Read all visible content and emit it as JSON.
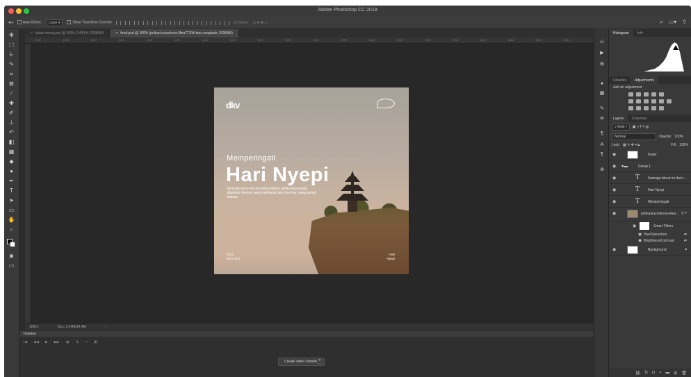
{
  "app": {
    "title": "Adobe Photoshop CC 2018"
  },
  "options_bar": {
    "auto_select_label": "Auto-Select:",
    "auto_select_value": "Layer",
    "transform_label": "Show Transform Controls",
    "mode_3d": "3D Mode:"
  },
  "tabs": [
    {
      "label": "lukas-mieraj.psd @ 100% (1443 H, RGB/8#)",
      "active": false
    },
    {
      "label": "feed.psd @ 100% (polina-kuzovkova-Mea7TXW-tsoc-unsplash, RGB/8#)",
      "active": true
    }
  ],
  "ruler_ticks": [
    "1000",
    "1050",
    "1100",
    "1150",
    "1200",
    "1250",
    "1300",
    "1350",
    "1400",
    "1450",
    "1500",
    "1550",
    "1600",
    "1650",
    "1700",
    "1750",
    "1800",
    "1850",
    "1900",
    "1950"
  ],
  "document": {
    "logo_left": "dkv",
    "pre_title": "Memperingati",
    "title": "Hari Nyepi",
    "body": "Semoga tahun ini dan tahun-tahun berikutnya selalu diberikan berkah yang melimpah dan hari-hari yang penuh makna.",
    "footer_left_line1": "2022",
    "footer_left_line2": "DKV UPJ",
    "footer_right_line1": "Hari",
    "footer_right_line2": "Nyepi"
  },
  "status": {
    "zoom": "100%",
    "doc": "Doc: 3.24M/34.4M"
  },
  "timeline": {
    "title": "Timeline",
    "create_button": "Create Video Timeline"
  },
  "panels": {
    "top_tabs": [
      "Histogram",
      "Info"
    ],
    "mid_tabs": [
      "Libraries",
      "Adjustments"
    ],
    "adjustments_label": "Add an adjustment",
    "layer_tabs": [
      "Layers",
      "Channels"
    ],
    "kind": "Kind",
    "blend_mode": "Normal",
    "opacity_label": "Opacity:",
    "opacity_value": "100%",
    "lock_label": "Lock:",
    "fill_label": "Fill:",
    "fill_value": "100%",
    "layers": [
      {
        "name": "footer",
        "type": "thumb"
      },
      {
        "name": "Group 1",
        "type": "group"
      },
      {
        "name": "Semoga tahun ini dan t...",
        "type": "text"
      },
      {
        "name": "Hari Nyepi",
        "type": "text"
      },
      {
        "name": "Memperingati",
        "type": "text"
      },
      {
        "name": "polina-kuzovkova-Mea...",
        "type": "smart"
      }
    ],
    "smart_filters": "Smart Filters",
    "filters": [
      "Hue/Saturation",
      "Brightness/Contrast"
    ],
    "background": "Background"
  }
}
